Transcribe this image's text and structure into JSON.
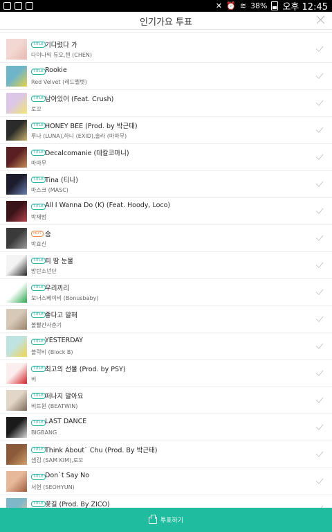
{
  "status_bar": {
    "battery": "38%",
    "time": "오후 12:45"
  },
  "header": {
    "title": "인기가요 투표"
  },
  "rows": [
    {
      "tag": "TITLE",
      "song": "기다렸다 가",
      "artist": "다이나믹 듀오,첸 (CHEN)",
      "thumb_colors": [
        "#f3d7d2",
        "#e6b9b1"
      ]
    },
    {
      "tag": "TITLE",
      "song": "Rookie",
      "artist": "Red Velvet (레드벨벳)",
      "thumb_colors": [
        "#6fb4c9",
        "#e6d34a"
      ]
    },
    {
      "tag": "TITLE",
      "song": "남아있어 (Feat. Crush)",
      "artist": "로꼬",
      "thumb_colors": [
        "#dcc7e7",
        "#f2e56f"
      ]
    },
    {
      "tag": "TITLE",
      "song": "HONEY BEE (Prod. by 박근태)",
      "artist": "루나 (LUNA),하니 (EXID),솔라 (마마무)",
      "thumb_colors": [
        "#2b2b2b",
        "#c8b36b"
      ]
    },
    {
      "tag": "TITLE",
      "song": "Decalcomanie (데칼코마니)",
      "artist": "마마무",
      "thumb_colors": [
        "#5a1f22",
        "#c88d58"
      ]
    },
    {
      "tag": "TITLE",
      "song": "Tina (티나)",
      "artist": "마스크 (MASC)",
      "thumb_colors": [
        "#1c1c2c",
        "#6a7fb4"
      ]
    },
    {
      "tag": "TITLE",
      "song": "All I Wanna Do (K) (Feat. Hoody, Loco)",
      "artist": "박재범",
      "thumb_colors": [
        "#3a1418",
        "#b3424f"
      ]
    },
    {
      "tag": "HOT",
      "song": "숨",
      "artist": "박효신",
      "thumb_colors": [
        "#3a3a3a",
        "#9a9a9a"
      ]
    },
    {
      "tag": "TITLE",
      "song": "피 땀 눈물",
      "artist": "방탄소년단",
      "thumb_colors": [
        "#f4f4f4",
        "#2a2a2a"
      ]
    },
    {
      "tag": "TITLE",
      "song": "우리끼리",
      "artist": "보너스베이비 (Bonusbaby)",
      "thumb_colors": [
        "#ffffff",
        "#2fa84f"
      ]
    },
    {
      "tag": "TITLE",
      "song": "좋다고 말해",
      "artist": "볼빨간사춘기",
      "thumb_colors": [
        "#d7c9b8",
        "#9c826a"
      ]
    },
    {
      "tag": "TITLE",
      "song": "YESTERDAY",
      "artist": "블락비 (Block B)",
      "thumb_colors": [
        "#bfe3e0",
        "#f3d44f"
      ]
    },
    {
      "tag": "TITLE",
      "song": "최고의 선물 (Prod. by PSY)",
      "artist": "비",
      "thumb_colors": [
        "#fbeeee",
        "#d32127"
      ]
    },
    {
      "tag": "TITLE",
      "song": "떠나지 말아요",
      "artist": "비트윈 (BEATWIN)",
      "thumb_colors": [
        "#e2d6c8",
        "#7e6a58"
      ]
    },
    {
      "tag": "TITLE",
      "song": "LAST DANCE",
      "artist": "BIGBANG",
      "thumb_colors": [
        "#1a1a1a",
        "#d8d8d8"
      ]
    },
    {
      "tag": "TITLE",
      "song": "Think About` Chu (Prod. By 박근태)",
      "artist": "샘김 (SAM KIM),로꼬",
      "thumb_colors": [
        "#8a5a3a",
        "#d2a06c"
      ]
    },
    {
      "tag": "TITLE",
      "song": "Don`t Say No",
      "artist": "서현 (SEOHYUN)",
      "thumb_colors": [
        "#e7b89a",
        "#9e5c3c"
      ]
    },
    {
      "tag": "TITLE",
      "song": "꽃길 (Prod. By ZICO)",
      "artist": "",
      "thumb_colors": [
        "#7fb7c8",
        "#e8c5a3"
      ]
    }
  ],
  "vote_button": {
    "label": "투표하기"
  }
}
